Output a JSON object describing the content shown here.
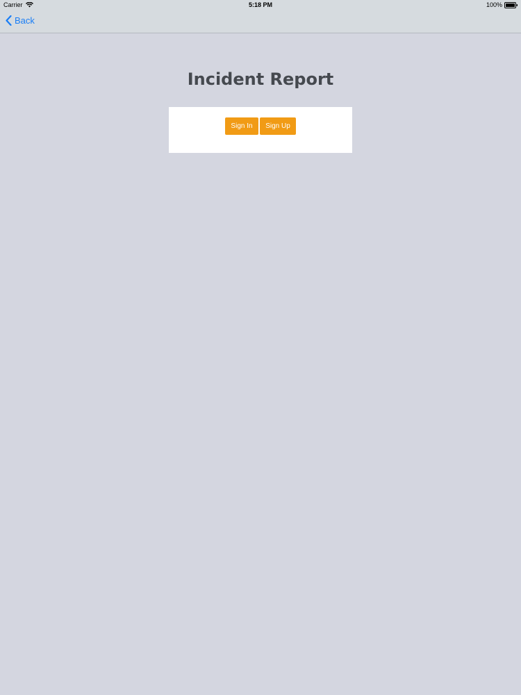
{
  "status_bar": {
    "carrier": "Carrier",
    "time": "5:18 PM",
    "battery": "100%",
    "wifi_icon": "wifi-icon",
    "battery_icon": "battery-icon"
  },
  "nav": {
    "back_label": "Back",
    "back_icon": "chevron-left-icon",
    "accent_color": "#1a7ef5"
  },
  "page": {
    "title": "Incident Report"
  },
  "auth": {
    "sign_in_label": "Sign In",
    "sign_up_label": "Sign Up",
    "button_color": "#f19b15"
  }
}
